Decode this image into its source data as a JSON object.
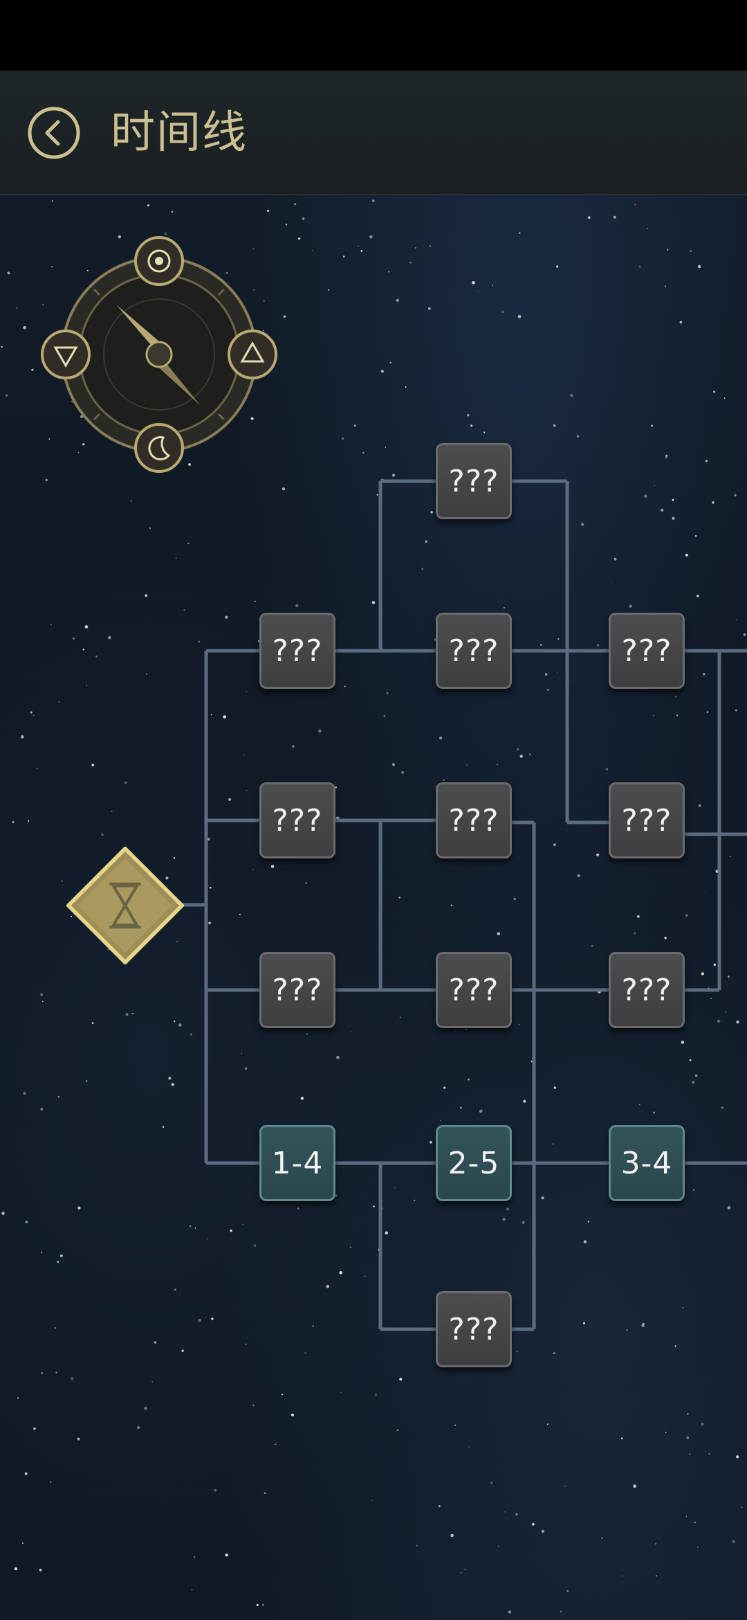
{
  "header": {
    "title": "时间线",
    "back_icon": "chevron-left-icon"
  },
  "colors": {
    "accent_gold": "#cdbf92",
    "line": "#5b6c80",
    "locked_node": "#48484a",
    "unlocked_node": "#30505a"
  },
  "compass": {
    "top_icon": "target-icon",
    "left_icon": "triangle-down-icon",
    "right_icon": "triangle-up-icon",
    "bottom_icon": "crescent-moon-icon"
  },
  "start_node": {
    "icon": "hourglass-icon"
  },
  "nodes": {
    "c1r1": "???",
    "c1r2": "???",
    "c1r3": "???",
    "c1r4": "1-4",
    "c2r0": "???",
    "c2r1": "???",
    "c2r2": "???",
    "c2r3": "???",
    "c2r4": "2-5",
    "c2r5": "???",
    "c3r1": "???",
    "c3r2": "???",
    "c3r3": "???",
    "c3r4": "3-4"
  }
}
